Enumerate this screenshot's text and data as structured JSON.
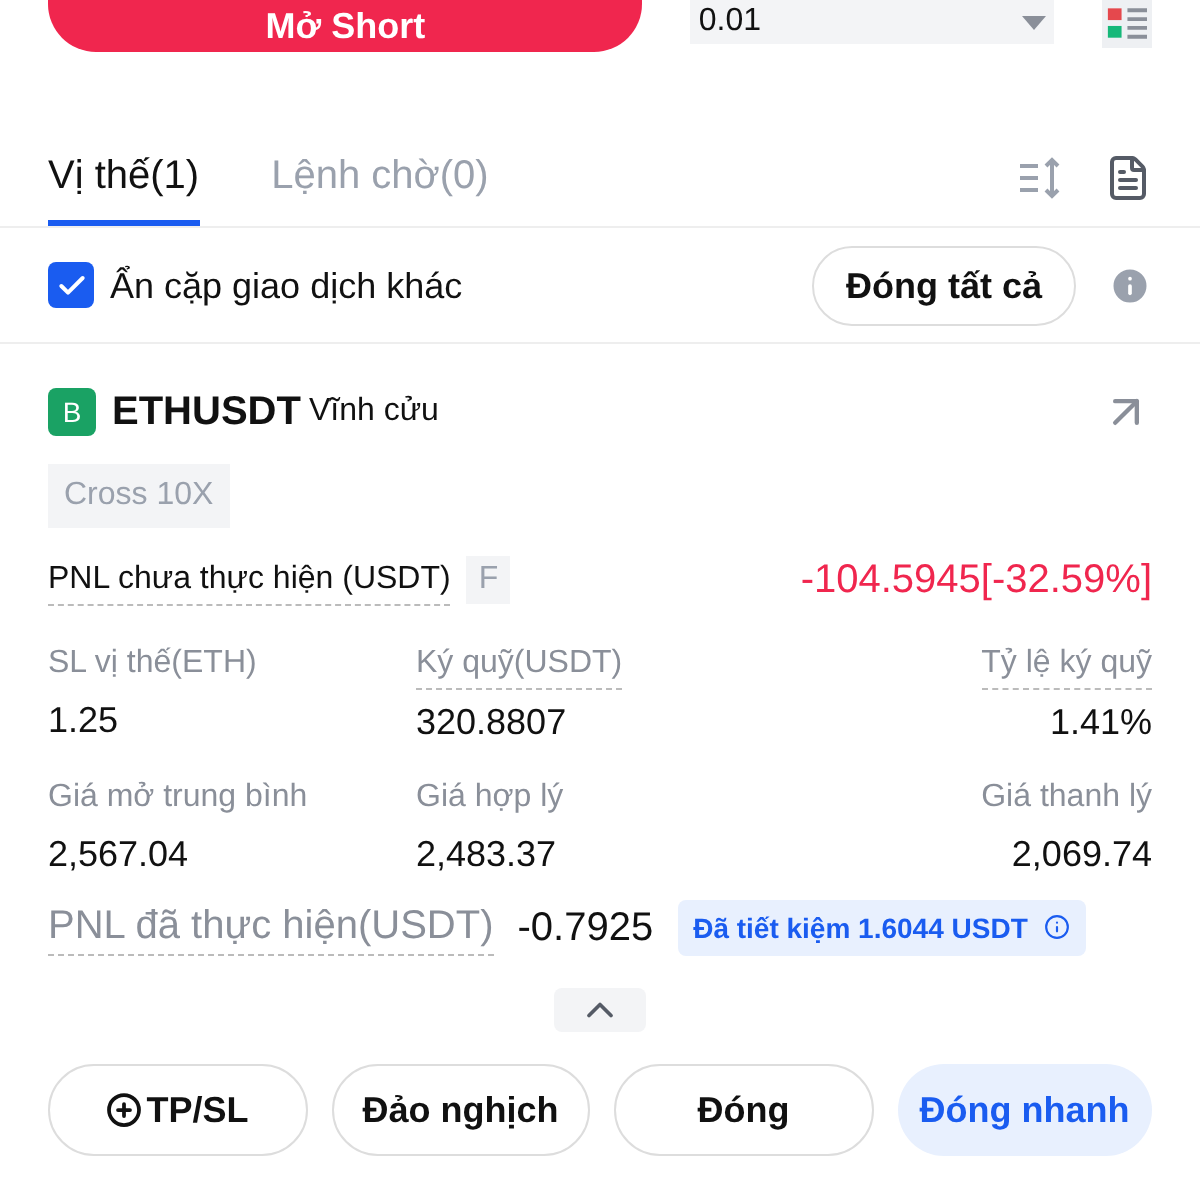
{
  "order_button": {
    "label": "Mở Short"
  },
  "quantity": {
    "value": "0.01"
  },
  "tabs": [
    {
      "label": "Vị thế(1)",
      "selected": true
    },
    {
      "label": "Lệnh chờ(0)",
      "selected": false
    }
  ],
  "hide_other_pairs": {
    "label": "Ẩn cặp giao dịch khác",
    "checked": true
  },
  "close_all": "Đóng tất cả",
  "position": {
    "side_badge": "B",
    "symbol": "ETHUSDT",
    "contract": "Vĩnh cửu",
    "margin_mode": "Cross 10X",
    "unrealized_label": "PNL chưa thực hiện (USDT)",
    "unrealized_tag": "F",
    "unrealized_value": "-104.5945[-32.59%]",
    "fields": [
      {
        "label": "SL vị thế(ETH)",
        "value": "1.25",
        "dotted": false
      },
      {
        "label": "Ký quỹ(USDT)",
        "value": "320.8807",
        "dotted": true
      },
      {
        "label": "Tỷ lệ ký quỹ",
        "value": "1.41%",
        "dotted": true
      },
      {
        "label": "Giá mở trung bình",
        "value": "2,567.04",
        "dotted": false
      },
      {
        "label": "Giá hợp lý",
        "value": "2,483.37",
        "dotted": false
      },
      {
        "label": "Giá thanh lý",
        "value": "2,069.74",
        "dotted": false
      }
    ],
    "realized_label": "PNL đã thực hiện(USDT)",
    "realized_value": "-0.7925",
    "saved": "Đã tiết kiệm 1.6044 USDT"
  },
  "actions": [
    {
      "label": "TP/SL",
      "kind": "add"
    },
    {
      "label": "Đảo nghịch",
      "kind": "plain"
    },
    {
      "label": "Đóng",
      "kind": "plain"
    },
    {
      "label": "Đóng nhanh",
      "kind": "primary"
    }
  ]
}
